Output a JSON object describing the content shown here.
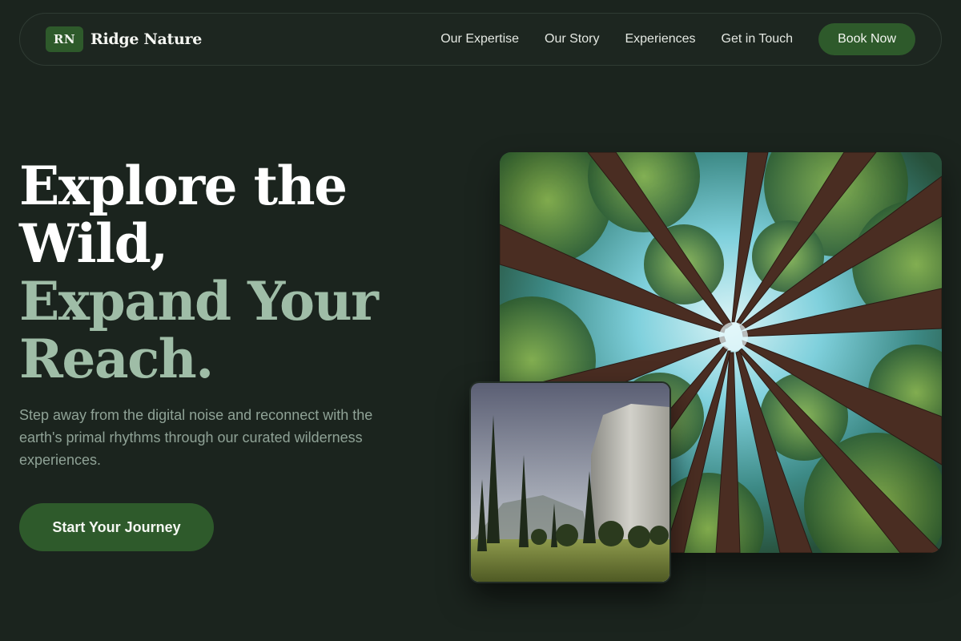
{
  "brand": {
    "logo_text": "RN",
    "name": "Ridge Nature"
  },
  "nav": {
    "links": [
      "Our Expertise",
      "Our Story",
      "Experiences",
      "Get in Touch"
    ],
    "cta_label": "Book Now"
  },
  "hero": {
    "title_lines": [
      "Explore the",
      "Wild,",
      "Expand Your",
      "Reach."
    ],
    "subtitle": "Step away from the digital noise and reconnect with the earth's primal rhythms through our curated wilderness experiences.",
    "cta_label": "Start Your Journey"
  },
  "images": {
    "large": {
      "subject": "redwood forest canopy looking up"
    },
    "small": {
      "subject": "granite cliff and meadow valley"
    }
  },
  "colors": {
    "background": "#1b241e",
    "accent": "#2e5a2b",
    "headline_secondary": "#9fbda7",
    "body_text": "#8fa296"
  }
}
